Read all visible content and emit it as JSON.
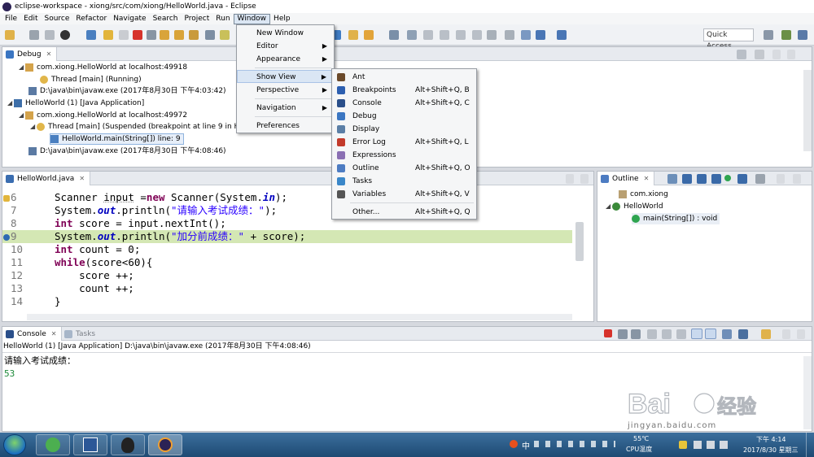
{
  "window": {
    "title": "eclipse-workspace - xiong/src/com/xiong/HelloWorld.java - Eclipse"
  },
  "menubar": [
    "File",
    "Edit",
    "Source",
    "Refactor",
    "Navigate",
    "Search",
    "Project",
    "Run",
    "Window",
    "Help"
  ],
  "toolbar": {
    "quick_access": "Quick Access"
  },
  "debug_view": {
    "tab": "Debug",
    "tree": [
      "com.xiong.HelloWorld at localhost:49918",
      "Thread [main] (Running)",
      "D:\\java\\bin\\javaw.exe (2017年8月30日 下午4:03:42)",
      "HelloWorld (1) [Java Application]",
      "com.xiong.HelloWorld at localhost:49972",
      "Thread [main] (Suspended (breakpoint at line 9 in He",
      "HelloWorld.main(String[]) line: 9",
      "D:\\java\\bin\\javaw.exe (2017年8月30日 下午4:08:46)"
    ]
  },
  "window_menu": {
    "items": [
      "New Window",
      "Editor",
      "Appearance",
      "Show View",
      "Perspective",
      "Navigation",
      "Preferences"
    ]
  },
  "show_view_menu": {
    "items": [
      {
        "label": "Ant",
        "shortcut": "",
        "icon_color": "#6b4a2b"
      },
      {
        "label": "Breakpoints",
        "shortcut": "Alt+Shift+Q, B",
        "icon_color": "#2d5fb0"
      },
      {
        "label": "Console",
        "shortcut": "Alt+Shift+Q, C",
        "icon_color": "#2a4f8a"
      },
      {
        "label": "Debug",
        "shortcut": "",
        "icon_color": "#3b76c2"
      },
      {
        "label": "Display",
        "shortcut": "",
        "icon_color": "#5b7fa6"
      },
      {
        "label": "Error Log",
        "shortcut": "Alt+Shift+Q, L",
        "icon_color": "#c23a2b"
      },
      {
        "label": "Expressions",
        "shortcut": "",
        "icon_color": "#8a6fb3"
      },
      {
        "label": "Outline",
        "shortcut": "Alt+Shift+Q, O",
        "icon_color": "#4d7cc2"
      },
      {
        "label": "Tasks",
        "shortcut": "",
        "icon_color": "#3a87c9"
      },
      {
        "label": "Variables",
        "shortcut": "Alt+Shift+Q, V",
        "icon_color": "#555555"
      },
      {
        "label": "Other...",
        "shortcut": "Alt+Shift+Q, Q",
        "icon_color": ""
      }
    ]
  },
  "editor": {
    "tab": "HelloWorld.java",
    "line_numbers": [
      "6",
      "7",
      "8",
      "9",
      "10",
      "11",
      "12",
      "13",
      "14"
    ],
    "highlighted_line": "9"
  },
  "outline": {
    "tab": "Outline",
    "items": [
      "com.xiong",
      "HelloWorld",
      "main(String[]) : void"
    ]
  },
  "console": {
    "tabs": [
      "Console",
      "Tasks"
    ],
    "header": "HelloWorld (1) [Java Application] D:\\java\\bin\\javaw.exe (2017年8月30日 下午4:08:46)",
    "lines": [
      "请输入考试成绩：",
      "53"
    ]
  },
  "watermark": {
    "logo": "Baidu 经验",
    "url": "jingyan.baidu.com"
  },
  "taskbar": {
    "temp": "55℃",
    "temp_label": "CPU温度",
    "ime": "中",
    "time": "下午 4:14",
    "date": "2017/8/30 星期三"
  }
}
